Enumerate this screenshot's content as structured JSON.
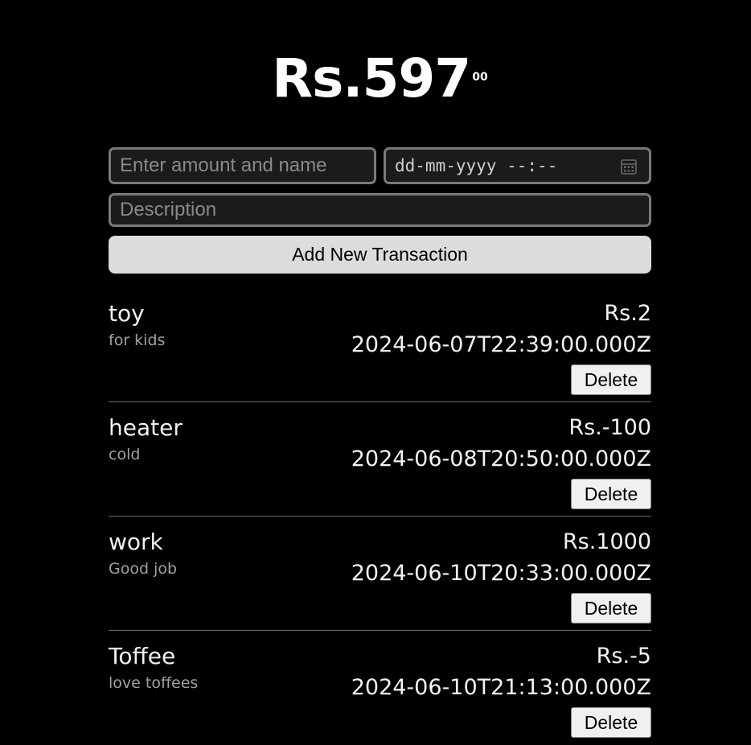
{
  "balance": {
    "main": "Rs.597",
    "cents": "00"
  },
  "form": {
    "amount_placeholder": "Enter amount and name",
    "datetime_placeholder": "dd-mm-yyyy --:--",
    "description_placeholder": "Description",
    "add_label": "Add New Transaction"
  },
  "transactions": [
    {
      "name": "toy",
      "description": "for kids",
      "amount": "Rs.2",
      "date": "2024-06-07T22:39:00.000Z",
      "delete_label": "Delete"
    },
    {
      "name": "heater",
      "description": "cold",
      "amount": "Rs.-100",
      "date": "2024-06-08T20:50:00.000Z",
      "delete_label": "Delete"
    },
    {
      "name": "work",
      "description": "Good job",
      "amount": "Rs.1000",
      "date": "2024-06-10T20:33:00.000Z",
      "delete_label": "Delete"
    },
    {
      "name": "Toffee",
      "description": "love toffees",
      "amount": "Rs.-5",
      "date": "2024-06-10T21:13:00.000Z",
      "delete_label": "Delete"
    }
  ],
  "icons": {
    "date_picker": "calendar-icon"
  }
}
